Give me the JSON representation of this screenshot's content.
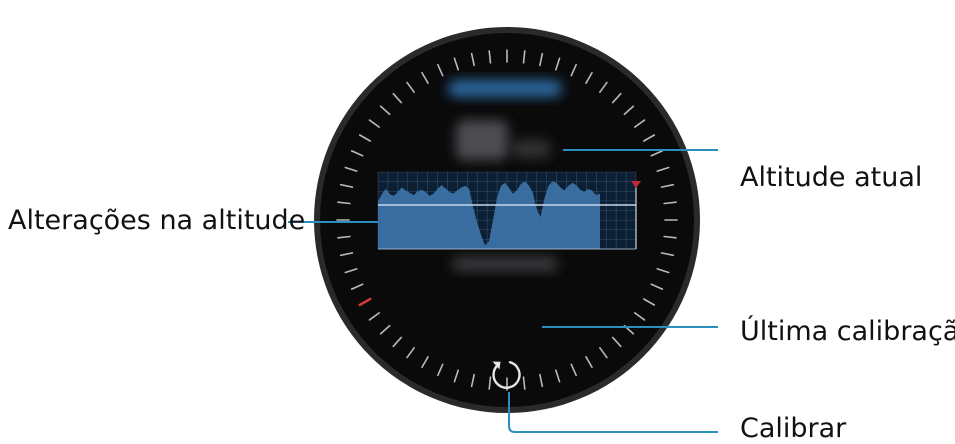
{
  "watch_screen": {
    "title": "",
    "current_altitude": "",
    "last_calibration": ""
  },
  "altitude_graph": {
    "fill_color": "#3d74a8",
    "line_color": "#c8d8ea",
    "marker_color": "#c0283a",
    "grid": true,
    "values": [
      0.62,
      0.72,
      0.78,
      0.71,
      0.69,
      0.74,
      0.8,
      0.76,
      0.73,
      0.7,
      0.75,
      0.77,
      0.74,
      0.69,
      0.72,
      0.78,
      0.83,
      0.79,
      0.74,
      0.72,
      0.76,
      0.8,
      0.82,
      0.78,
      0.55,
      0.35,
      0.18,
      0.05,
      0.1,
      0.38,
      0.66,
      0.82,
      0.86,
      0.8,
      0.72,
      0.76,
      0.84,
      0.88,
      0.83,
      0.74,
      0.52,
      0.42,
      0.66,
      0.82,
      0.88,
      0.86,
      0.8,
      0.76,
      0.82,
      0.86,
      0.83,
      0.77,
      0.74,
      0.78,
      0.76,
      0.7,
      0.72
    ]
  },
  "callouts": {
    "current_altitude": "Altitude atual",
    "altitude_changes": "Alterações na altitude",
    "last_calibration": "Última calibração",
    "calibrate": "Calibrar"
  },
  "icons": {
    "calibrate": "refresh-icon",
    "max_marker": "triangle-marker-icon"
  },
  "colors": {
    "screen_background": "#0a0a0b",
    "bezel_tick": "#d8d8d8",
    "bezel_accent_tick": "#d23a3a",
    "callout_line": "#2a8fbf"
  }
}
